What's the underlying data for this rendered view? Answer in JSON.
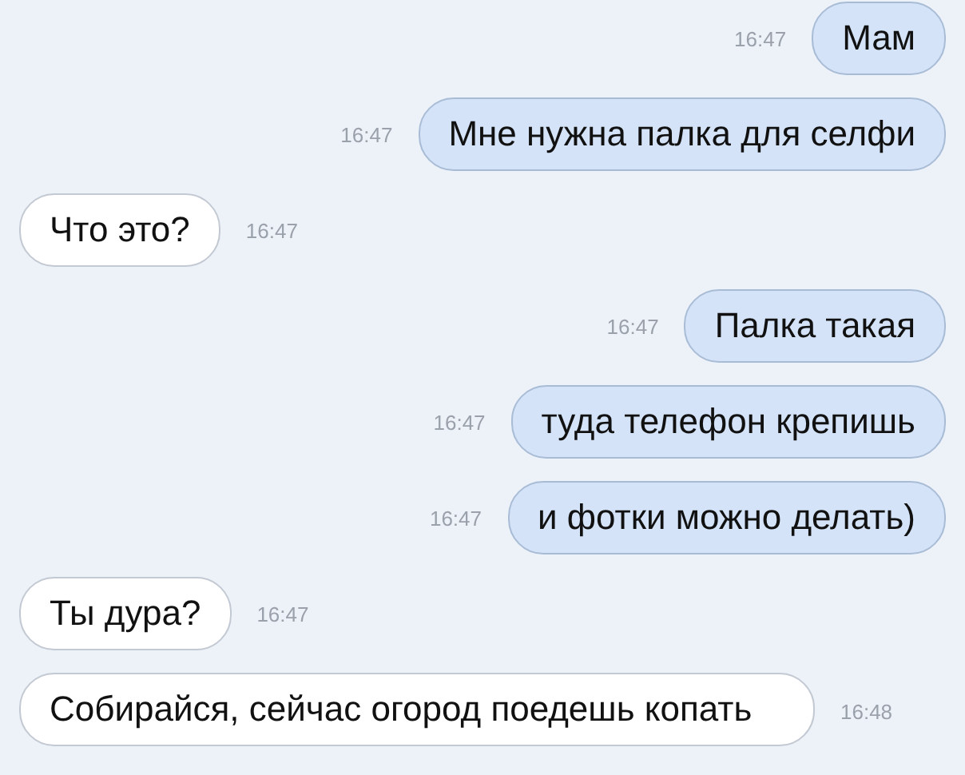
{
  "messages": [
    {
      "kind": "outgoing",
      "text": "Мам",
      "time": "16:47"
    },
    {
      "kind": "outgoing",
      "text": "Мне нужна палка для селфи",
      "time": "16:47"
    },
    {
      "kind": "incoming",
      "text": "Что это?",
      "time": "16:47"
    },
    {
      "kind": "outgoing",
      "text": "Палка такая",
      "time": "16:47"
    },
    {
      "kind": "outgoing",
      "text": "туда телефон крепишь",
      "time": "16:47"
    },
    {
      "kind": "outgoing",
      "text": "и фотки можно делать)",
      "time": "16:47"
    },
    {
      "kind": "incoming",
      "text": "Ты дура?",
      "time": "16:47"
    },
    {
      "kind": "incoming",
      "text": "Собирайся, сейчас огород поедешь копать",
      "time": "16:48"
    }
  ]
}
